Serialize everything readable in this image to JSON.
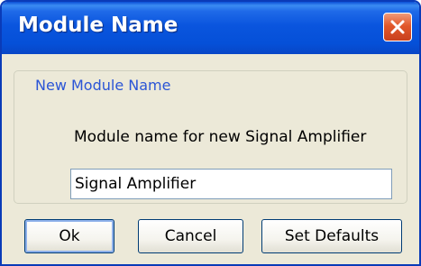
{
  "window": {
    "title": "Module Name"
  },
  "group": {
    "legend": "New Module Name",
    "prompt": "Module name for new Signal Amplifier",
    "input_value": "Signal Amplifier"
  },
  "buttons": {
    "ok_label": "Ok",
    "cancel_label": "Cancel",
    "defaults_label": "Set Defaults"
  },
  "icons": {
    "close": "close-icon"
  },
  "colors": {
    "titlebar": "#0a55de",
    "close_button": "#e2582a",
    "dialog_background": "#ece9d8",
    "group_legend": "#2b55d6"
  }
}
